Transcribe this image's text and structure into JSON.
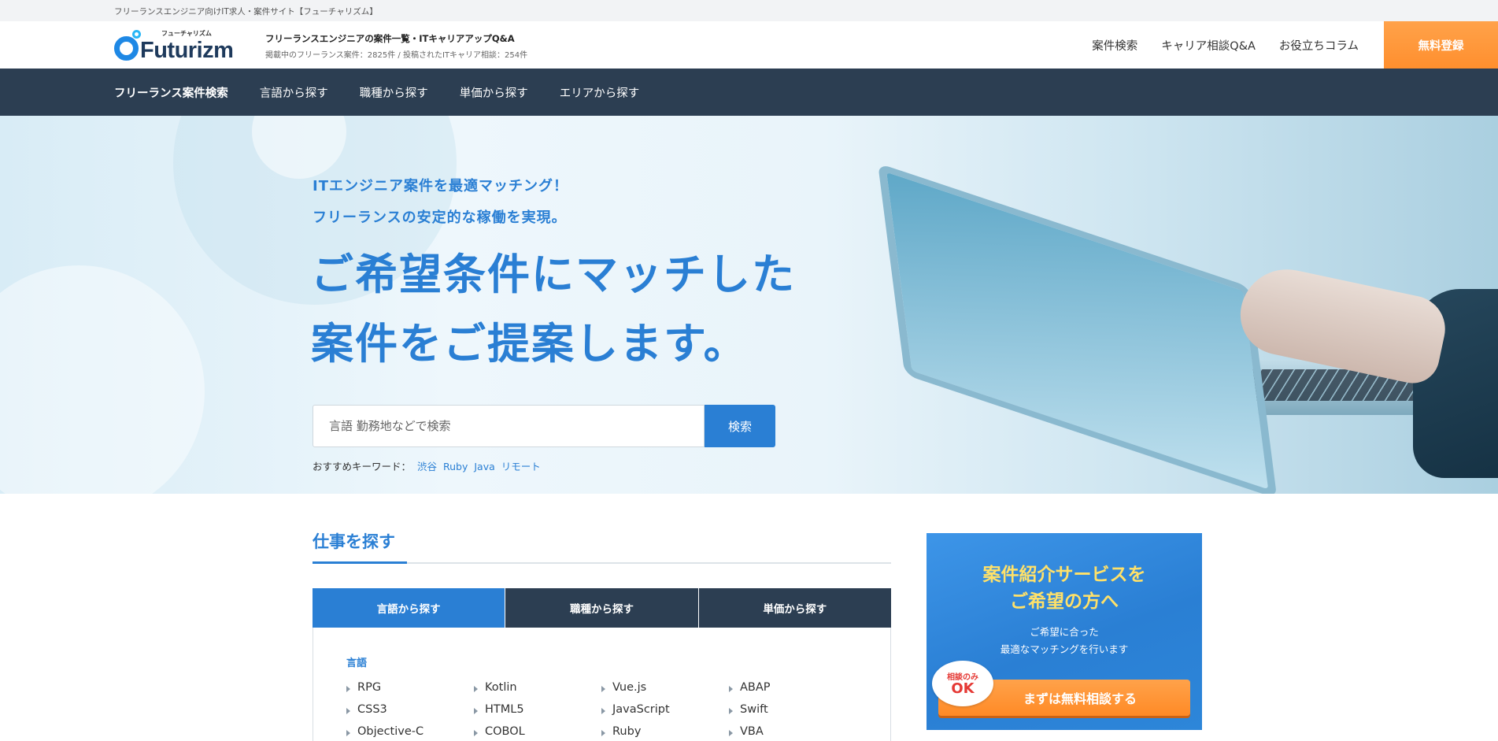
{
  "topstrip": {
    "text": "フリーランスエンジニア向けIT求人・案件サイト【フューチャリズム】"
  },
  "header": {
    "logo_kana": "フューチャリズム",
    "logo_word": "Futurizm",
    "tagline_main": "フリーランスエンジニアの案件一覧・ITキャリアアップQ&A",
    "tagline_sub": "掲載中のフリーランス案件：2825件 / 投稿されたITキャリア相談：254件",
    "nav": [
      "案件検索",
      "キャリア相談Q&A",
      "お役立ちコラム"
    ],
    "register_label": "無料登録"
  },
  "mainnav": {
    "items": [
      "フリーランス案件検索",
      "言語から探す",
      "職種から探す",
      "単価から探す",
      "エリアから探す"
    ]
  },
  "hero": {
    "catch1": "ITエンジニア案件を最適マッチング！",
    "catch2": "フリーランスの安定的な稼働を実現。",
    "headline1": "ご希望条件にマッチした",
    "headline2": "案件をご提案します。",
    "search_placeholder": "言語 勤務地などで検索",
    "search_button": "検索",
    "keyword_label": "おすすめキーワード：",
    "keywords": [
      "渋谷",
      "Ruby",
      "Java",
      "リモート"
    ]
  },
  "jobs": {
    "title": "仕事を探す",
    "tabs": [
      "言語から探す",
      "職種から探す",
      "単価から探す"
    ],
    "panel_label": "言語",
    "languages": [
      "RPG",
      "Kotlin",
      "Vue.js",
      "ABAP",
      "CSS3",
      "HTML5",
      "JavaScript",
      "Swift",
      "Objective-C",
      "COBOL",
      "Ruby",
      "VBA"
    ]
  },
  "banner": {
    "head1": "案件紹介サービスを",
    "head2": "ご希望の方へ",
    "sub1": "ご希望に合った",
    "sub2": "最適なマッチングを行います",
    "badge_small": "相談のみ",
    "badge_large": "OK",
    "cta": "まずは無料相談する"
  },
  "colors": {
    "accent": "#2a7fd4",
    "nav_dark": "#2c3e52",
    "cta_orange": "#ff8f2e",
    "banner_yellow": "#ffe169"
  }
}
